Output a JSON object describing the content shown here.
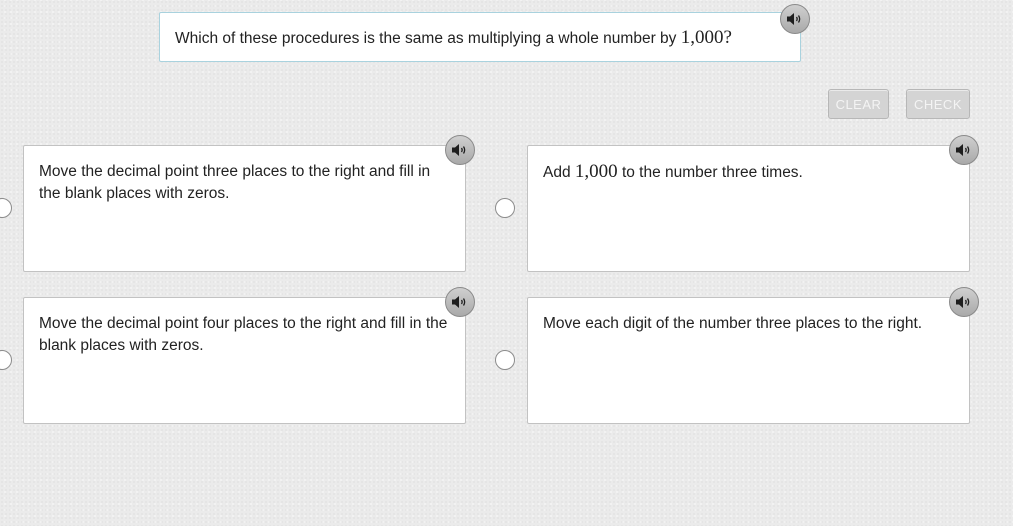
{
  "question": {
    "text_before": "Which of these procedures is the same as multiplying a whole number by ",
    "math": "1,000",
    "text_after": "?"
  },
  "buttons": {
    "clear_label": "CLEAR",
    "check_label": "CHECK"
  },
  "options": [
    {
      "text": "Move the decimal point three places to the right and fill in the blank places with zeros."
    },
    {
      "text_before": "Add ",
      "math": "1,000",
      "text_after": " to the number three times."
    },
    {
      "text": "Move the decimal point four places to the right and fill in the blank places with zeros."
    },
    {
      "text": "Move each digit of the number three places to the right."
    }
  ],
  "icons": {
    "audio": "speaker-icon",
    "choice": "radio-button"
  },
  "colors": {
    "background": "#ebebeb",
    "question_border": "#a9d2de",
    "button_bg": "#d4d4d4",
    "button_text": "#f4f4f4",
    "card_border": "#c2c2c2",
    "speaker_bg": "#b9b9b9"
  }
}
